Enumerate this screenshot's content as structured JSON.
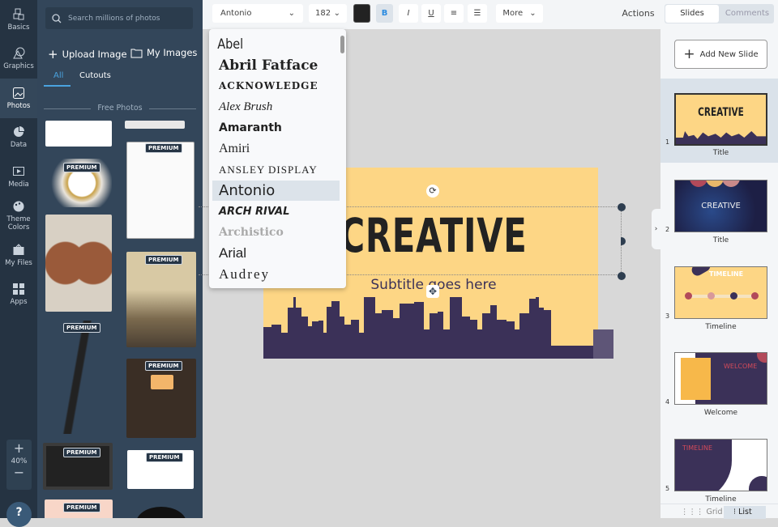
{
  "rail": {
    "items": [
      {
        "label": "Basics"
      },
      {
        "label": "Graphics"
      },
      {
        "label": "Photos"
      },
      {
        "label": "Data"
      },
      {
        "label": "Media"
      },
      {
        "label": "Theme Colors"
      },
      {
        "label": "My Files"
      },
      {
        "label": "Apps"
      }
    ],
    "zoom": "40%",
    "help": "?"
  },
  "panel": {
    "search_placeholder": "Search millions of photos",
    "upload": "Upload Image",
    "my_images": "My Images",
    "tabs": [
      "All",
      "Cutouts"
    ],
    "section": "Free Photos",
    "premium": "PREMIUM"
  },
  "toolbar": {
    "font": "Antonio",
    "size": "182",
    "bold": "B",
    "italic": "I",
    "underline": "U",
    "more": "More",
    "actions": "Actions",
    "color": "#222222"
  },
  "fonts": [
    "Abel",
    "Abril Fatface",
    "ACKNOWLEDGE",
    "Alex Brush",
    "Amaranth",
    "Amiri",
    "ANSLEY DISPLAY",
    "Antonio",
    "ARCH RIVAL",
    "Archistico",
    "Arial",
    "Audrey"
  ],
  "slide": {
    "title": "CREATIVE",
    "subtitle": "Subtitle goes here",
    "bg": "#fdd685",
    "skyline": "#3b3158"
  },
  "right": {
    "tabs": [
      "Slides",
      "Comments"
    ],
    "add": "Add New Slide",
    "slides": [
      {
        "num": "1",
        "label": "Title",
        "thumb_title": "CREATIVE"
      },
      {
        "num": "2",
        "label": "Title",
        "thumb_title": "CREATIVE"
      },
      {
        "num": "3",
        "label": "Timeline",
        "thumb_title": "TIMELINE"
      },
      {
        "num": "4",
        "label": "Welcome",
        "thumb_title": "WELCOME"
      },
      {
        "num": "5",
        "label": "Timeline",
        "thumb_title": "TIMELINE"
      }
    ],
    "grid": "Grid",
    "list": "List"
  }
}
